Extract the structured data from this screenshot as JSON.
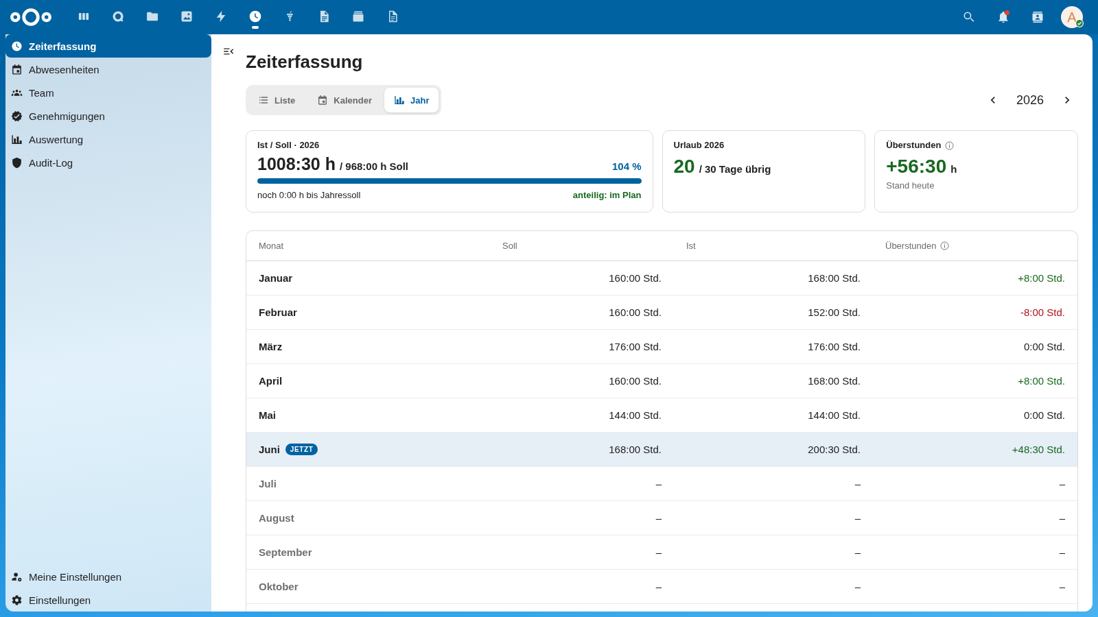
{
  "header": {
    "apps": [
      {
        "selected": false
      },
      {
        "selected": false
      },
      {
        "selected": false
      },
      {
        "selected": false
      },
      {
        "selected": false
      },
      {
        "selected": true
      },
      {
        "selected": false
      },
      {
        "selected": false
      },
      {
        "selected": false
      },
      {
        "selected": false
      }
    ],
    "notifications": {
      "unread": true
    },
    "avatar": {
      "initial": "A",
      "online": true
    }
  },
  "sidebar": {
    "items": [
      {
        "label": "Zeiterfassung",
        "selected": true
      },
      {
        "label": "Abwesenheiten",
        "selected": false
      },
      {
        "label": "Team",
        "selected": false
      },
      {
        "label": "Genehmigungen",
        "selected": false
      },
      {
        "label": "Auswertung",
        "selected": false
      },
      {
        "label": "Audit-Log",
        "selected": false
      }
    ],
    "footer_items": [
      {
        "label": "Meine Einstellungen"
      },
      {
        "label": "Einstellungen"
      }
    ]
  },
  "page": {
    "title": "Zeiterfassung",
    "views": [
      {
        "label": "Liste",
        "selected": false
      },
      {
        "label": "Kalender",
        "selected": false
      },
      {
        "label": "Jahr",
        "selected": true
      }
    ],
    "year": "2026"
  },
  "cards": [
    {
      "kind": "progress",
      "label": "Ist / Soll · 2026",
      "info": false,
      "value": "1008:30 h",
      "positive": false,
      "target": "/ 968:00 h Soll",
      "percent": "104 %",
      "level": 1,
      "remaining": "noch 0:00 h bis Jahressoll",
      "status": "anteilig: im Plan",
      "on_track": true
    },
    {
      "kind": "balance",
      "label": "Urlaub 2026",
      "info": false,
      "value": "20",
      "positive": true,
      "suffix": "/ 30 Tage übrig"
    },
    {
      "kind": "balance",
      "label": "Überstunden",
      "info": true,
      "value": "+56:30",
      "positive": true,
      "suffix": "h",
      "note": "Stand heute"
    }
  ],
  "table": {
    "columns": [
      {
        "label": "Monat",
        "info": false
      },
      {
        "label": "Soll",
        "info": false
      },
      {
        "label": "Ist",
        "info": false
      },
      {
        "label": "Überstunden",
        "info": true
      }
    ],
    "rows": [
      {
        "month": "Januar",
        "soll": "160:00 Std.",
        "ist": "168:00 Std.",
        "overtime": "+8:00 Std.",
        "positive": true,
        "negative": false,
        "current": false,
        "upcoming": false
      },
      {
        "month": "Februar",
        "soll": "160:00 Std.",
        "ist": "152:00 Std.",
        "overtime": "-8:00 Std.",
        "positive": false,
        "negative": true,
        "current": false,
        "upcoming": false
      },
      {
        "month": "März",
        "soll": "176:00 Std.",
        "ist": "176:00 Std.",
        "overtime": "0:00 Std.",
        "positive": false,
        "negative": false,
        "current": false,
        "upcoming": false
      },
      {
        "month": "April",
        "soll": "160:00 Std.",
        "ist": "168:00 Std.",
        "overtime": "+8:00 Std.",
        "positive": true,
        "negative": false,
        "current": false,
        "upcoming": false
      },
      {
        "month": "Mai",
        "soll": "144:00 Std.",
        "ist": "144:00 Std.",
        "overtime": "0:00 Std.",
        "positive": false,
        "negative": false,
        "current": false,
        "upcoming": false
      },
      {
        "month": "Juni",
        "badge": "JETZT",
        "soll": "168:00 Std.",
        "ist": "200:30 Std.",
        "overtime": "+48:30 Std.",
        "positive": true,
        "negative": false,
        "current": true,
        "upcoming": false
      },
      {
        "month": "Juli",
        "soll": "–",
        "ist": "–",
        "overtime": "–",
        "positive": false,
        "negative": false,
        "current": false,
        "upcoming": true
      },
      {
        "month": "August",
        "soll": "–",
        "ist": "–",
        "overtime": "–",
        "positive": false,
        "negative": false,
        "current": false,
        "upcoming": true
      },
      {
        "month": "September",
        "soll": "–",
        "ist": "–",
        "overtime": "–",
        "positive": false,
        "negative": false,
        "current": false,
        "upcoming": true
      },
      {
        "month": "Oktober",
        "soll": "–",
        "ist": "–",
        "overtime": "–",
        "positive": false,
        "negative": false,
        "current": false,
        "upcoming": true
      }
    ]
  }
}
